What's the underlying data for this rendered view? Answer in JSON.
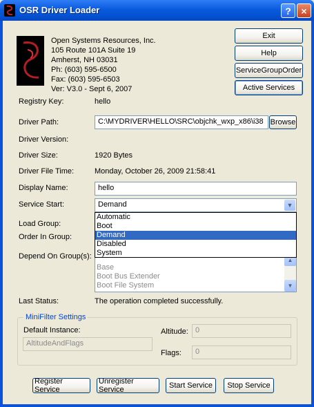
{
  "window": {
    "title": "OSR Driver Loader",
    "help_button": "?",
    "close_button": "×"
  },
  "company": {
    "name": "Open Systems Resources, Inc.",
    "address1": "105 Route 101A Suite 19",
    "address2": "Amherst, NH 03031",
    "phone": "Ph:  (603) 595-6500",
    "fax": "Fax: (603) 595-6503",
    "version": "Ver: V3.0  -  Sept 6, 2007"
  },
  "side_buttons": {
    "exit": "Exit",
    "help": "Help",
    "service_group_order": "ServiceGroupOrder",
    "active_services": "Active Services"
  },
  "fields": {
    "registry_key_label": "Registry Key:",
    "registry_key_value": "hello",
    "driver_path_label": "Driver Path:",
    "driver_path_value": "C:\\MYDRIVER\\HELLO\\SRC\\objchk_wxp_x86\\i38",
    "browse": "Browse",
    "driver_version_label": "Driver Version:",
    "driver_size_label": "Driver Size:",
    "driver_size_value": "1920 Bytes",
    "driver_file_time_label": "Driver File Time:",
    "driver_file_time_value": "Monday, October 26, 2009 21:58:41",
    "display_name_label": "Display Name:",
    "display_name_value": "hello",
    "service_start_label": "Service Start:",
    "service_start_value": "Demand",
    "load_group_label": "Load Group:",
    "order_in_group_label": "Order In Group:",
    "depend_on_groups_label": "Depend On Group(s):",
    "last_status_label": "Last Status:",
    "last_status_value": "The operation completed successfully."
  },
  "service_start_options": [
    "Automatic",
    "Boot",
    "Demand",
    "Disabled",
    "System"
  ],
  "depend_on_groups": [
    "Base",
    "Boot Bus Extender",
    "Boot File System"
  ],
  "minifilter": {
    "title": "MiniFilter Settings",
    "default_instance_label": "Default Instance:",
    "default_instance_value": "AltitudeAndFlags",
    "altitude_label": "Altitude:",
    "altitude_value": "0",
    "flags_label": "Flags:",
    "flags_value": "0"
  },
  "bottom_buttons": {
    "register": "Register Service",
    "unregister": "Unregister Service",
    "start": "Start Service",
    "stop": "Stop Service"
  },
  "colors": {
    "titlebar": "#0a5bdc",
    "selection": "#316ac5",
    "face": "#ece9d8"
  }
}
